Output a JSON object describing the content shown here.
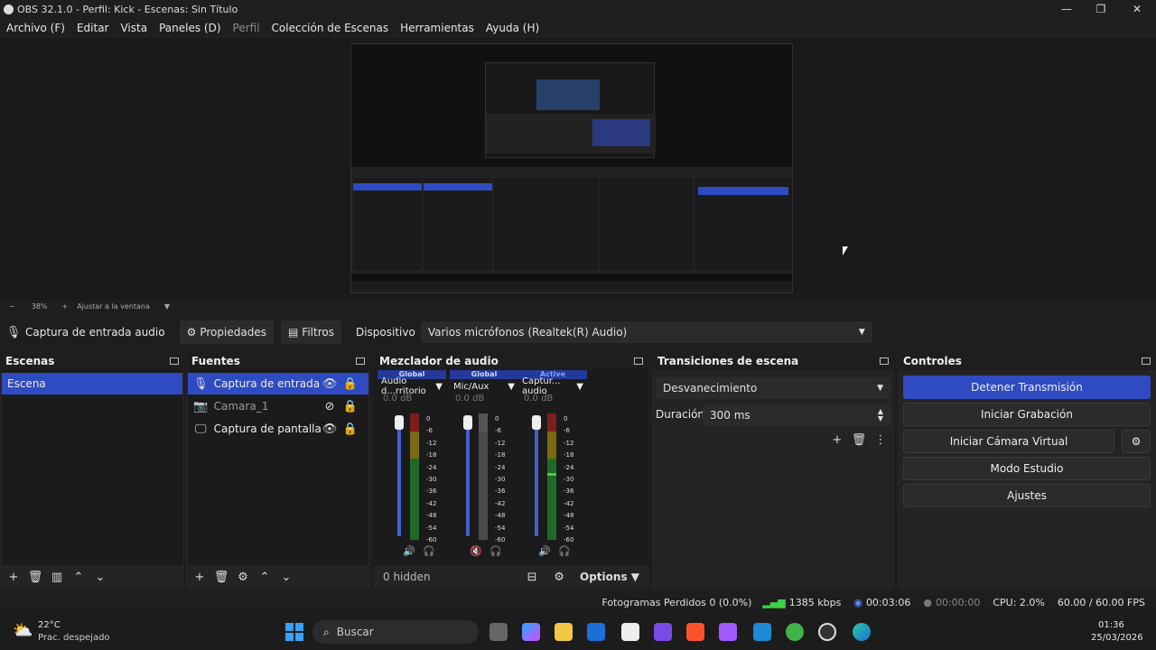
{
  "window": {
    "title": "OBS 32.1.0 - Perfil: Kick - Escenas: Sin Título"
  },
  "menu": {
    "items": [
      "Archivo (F)",
      "Editar",
      "Vista",
      "Paneles (D)",
      "Perfil",
      "Colección de Escenas",
      "Herramientas",
      "Ayuda (H)"
    ]
  },
  "zoom": {
    "level": "38%",
    "fit_label": "Ajustar a la ventana"
  },
  "source_toolbar": {
    "source_name": "Captura de entrada audio",
    "properties_label": "Propiedades",
    "filters_label": "Filtros",
    "device_label": "Dispositivo",
    "device_value": "Varios micrófonos (Realtek(R) Audio)"
  },
  "scenes": {
    "title": "Escenas",
    "items": [
      "Escena"
    ]
  },
  "sources": {
    "title": "Fuentes",
    "items": [
      "Captura de entrada audio",
      "Camara_1",
      "Captura de pantalla"
    ]
  },
  "mixer": {
    "title": "Mezclador de audio",
    "channels": [
      {
        "tag": "Global",
        "name": "Audio d...rritorio",
        "db": "0.0 dB"
      },
      {
        "tag": "Global",
        "name": "Mic/Aux",
        "db": "0.0 dB"
      },
      {
        "tag": "Active",
        "name": "Captur... audio",
        "db": "0.0 dB"
      }
    ],
    "ticks": [
      "0",
      "-6",
      "-12",
      "-18",
      "-24",
      "-30",
      "-36",
      "-42",
      "-48",
      "-54",
      "-60"
    ],
    "hidden_label": "0 hidden",
    "options_label": "Options"
  },
  "transitions": {
    "title": "Transiciones de escena",
    "type": "Desvanecimiento",
    "duration_label": "Duración",
    "duration_value": "300 ms"
  },
  "controls": {
    "title": "Controles",
    "stop_stream": "Detener Transmisión",
    "start_recording": "Iniciar Grabación",
    "start_virtual_cam": "Iniciar Cámara Virtual",
    "studio_mode": "Modo Estudio",
    "settings": "Ajustes"
  },
  "status": {
    "dropped_frames": "Fotogramas Perdidos 0 (0.0%)",
    "bitrate": "1385 kbps",
    "stream_time": "00:03:06",
    "rec_time": "00:00:00",
    "cpu": "CPU: 2.0%",
    "fps": "60.00 / 60.00 FPS"
  },
  "taskbar": {
    "weather_temp": "22°C",
    "weather_desc": "Prac. despejado",
    "search_placeholder": "Buscar",
    "time": "01:36",
    "date": "25/03/2026"
  },
  "colors": {
    "accent": "#2f4bc2",
    "panel": "#242424",
    "background": "#1e1e1e"
  }
}
